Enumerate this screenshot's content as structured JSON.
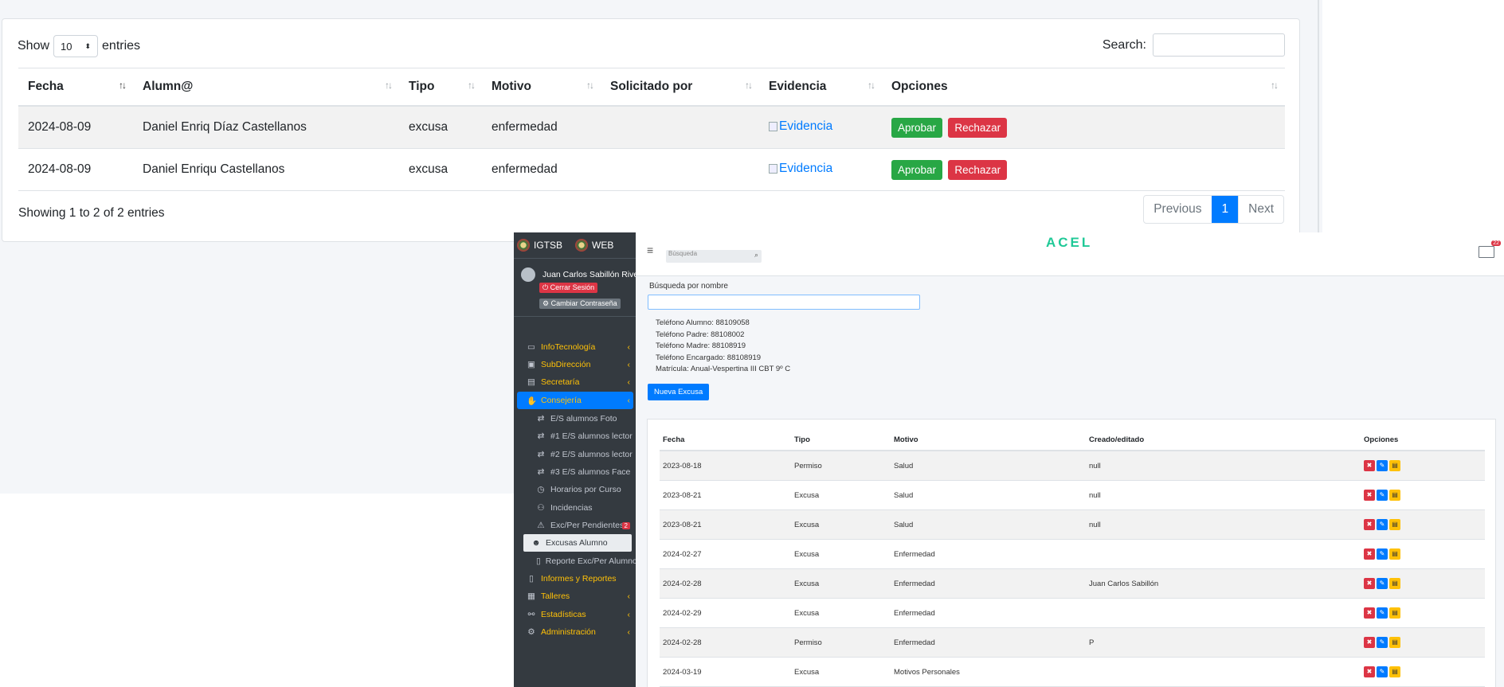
{
  "top": {
    "show_label": "Show",
    "entries_label": "entries",
    "page_length": "10",
    "search_label": "Search:",
    "columns": [
      "Fecha",
      "Alumn@",
      "Tipo",
      "Motivo",
      "Solicitado por",
      "Evidencia",
      "Opciones"
    ],
    "rows": [
      {
        "fecha": "2024-08-09",
        "alumno": "Daniel Enriq   Díaz Castellanos",
        "tipo": "excusa",
        "motivo": "enfermedad",
        "solicitado": "",
        "evidencia": "Evidencia"
      },
      {
        "fecha": "2024-08-09",
        "alumno": "Daniel Enriqu     Castellanos",
        "tipo": "excusa",
        "motivo": "enfermedad",
        "solicitado": "",
        "evidencia": "Evidencia"
      }
    ],
    "approve_label": "Aprobar",
    "reject_label": "Rechazar",
    "info": "Showing 1 to 2 of 2 entries",
    "pager": {
      "previous": "Previous",
      "current": "1",
      "next": "Next"
    }
  },
  "app": {
    "brand_left": "IGTSB",
    "brand_right": "WEB",
    "user_name": "Juan Carlos Sabillón Rivera",
    "logout": "Cerrar Sesión",
    "change_password": "Cambiar Contraseña",
    "nav": [
      {
        "label": "InfoTecnología",
        "icon": "laptop-icon"
      },
      {
        "label": "SubDirección",
        "icon": "briefcase-icon"
      },
      {
        "label": "Secretaría",
        "icon": "id-card-icon"
      },
      {
        "label": "Consejería",
        "icon": "handshake-icon"
      },
      {
        "label": "E/S alumnos Foto",
        "icon": "exchange-icon"
      },
      {
        "label": "#1 E/S alumnos lector",
        "icon": "exchange-icon"
      },
      {
        "label": "#2 E/S alumnos lector",
        "icon": "exchange-icon"
      },
      {
        "label": "#3 E/S alumnos Face",
        "icon": "exchange-icon"
      },
      {
        "label": "Horarios por Curso",
        "icon": "clock-icon"
      },
      {
        "label": "Incidencias",
        "icon": "users-icon"
      },
      {
        "label": "Exc/Per Pendientes",
        "icon": "warning-icon",
        "badge": "2"
      },
      {
        "label": "Excusas Alumno",
        "icon": "user-icon"
      },
      {
        "label": "Reporte Exc/Per Alumno",
        "icon": "clipboard-icon"
      },
      {
        "label": "Informes y Reportes",
        "icon": "clipboard-icon"
      },
      {
        "label": "Talleres",
        "icon": "toolbox-icon"
      },
      {
        "label": "Estadísticas",
        "icon": "sitemap-icon"
      },
      {
        "label": "Administración",
        "icon": "cog-icon"
      }
    ],
    "search_placeholder": "Búsqueda",
    "logo_text": "ACEL",
    "mail_count": "22",
    "search_by_name": "Búsqueda por nombre",
    "info_lines": [
      "Teléfono Alumno: 88109058",
      "Teléfono Padre: 88108002",
      "Teléfono Madre: 88108919",
      "Teléfono Encargado: 88108919",
      "Matrícula: Anual-Vespertina III CBT 9º C"
    ],
    "new_excuse": "Nueva Excusa",
    "columns": [
      "Fecha",
      "Tipo",
      "Motivo",
      "Creado/editado",
      "Opciones"
    ],
    "rows": [
      {
        "fecha": "2023-08-18",
        "tipo": "Permiso",
        "motivo": "Salud",
        "creado": "null"
      },
      {
        "fecha": "2023-08-21",
        "tipo": "Excusa",
        "motivo": "Salud",
        "creado": "null"
      },
      {
        "fecha": "2023-08-21",
        "tipo": "Excusa",
        "motivo": "Salud",
        "creado": "null"
      },
      {
        "fecha": "2024-02-27",
        "tipo": "Excusa",
        "motivo": "Enfermedad",
        "creado": ""
      },
      {
        "fecha": "2024-02-28",
        "tipo": "Excusa",
        "motivo": "Enfermedad",
        "creado": "Juan Carlos Sabillón"
      },
      {
        "fecha": "2024-02-29",
        "tipo": "Excusa",
        "motivo": "Enfermedad",
        "creado": ""
      },
      {
        "fecha": "2024-02-28",
        "tipo": "Permiso",
        "motivo": "Enfermedad",
        "creado": "P"
      },
      {
        "fecha": "2024-03-19",
        "tipo": "Excusa",
        "motivo": "Motivos Personales",
        "creado": ""
      }
    ]
  }
}
